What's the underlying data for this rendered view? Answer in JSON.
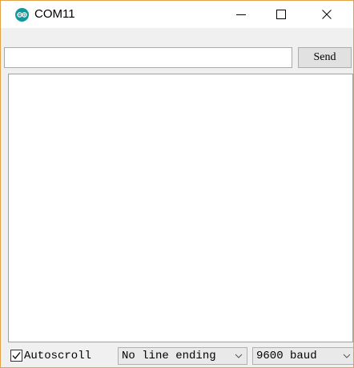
{
  "window": {
    "title": "COM11",
    "icon": "arduino-logo-icon",
    "controls": [
      "minimize-icon",
      "maximize-icon",
      "close-icon"
    ]
  },
  "send_bar": {
    "input_value": "",
    "send_label": "Send"
  },
  "bottom_bar": {
    "autoscroll_label": "Autoscroll",
    "autoscroll_checked": true,
    "line_ending_selected": "No line ending",
    "baud_selected": "9600 baud"
  },
  "colors": {
    "window_border": "#e3a24a",
    "app_icon": "#13979c",
    "background": "#f0f0f0"
  }
}
